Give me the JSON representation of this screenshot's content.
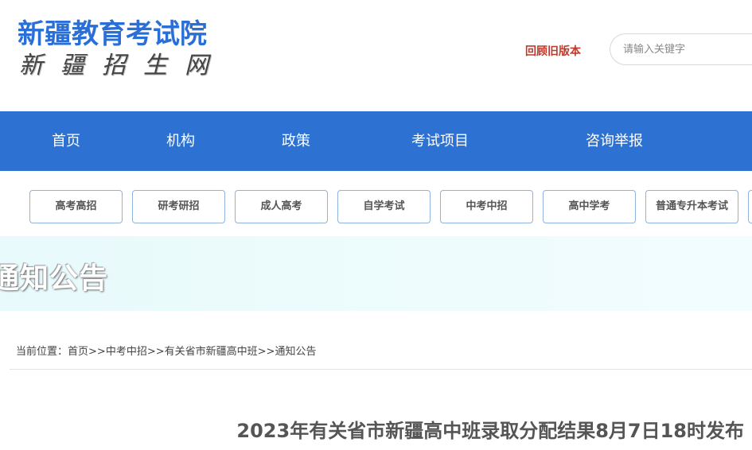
{
  "header": {
    "site_title": "新疆教育考试院",
    "site_subtitle": "新疆招生网",
    "old_version_link": "回顾旧版本",
    "search_placeholder": "请输入关键字"
  },
  "main_nav": {
    "items": [
      {
        "label": "首页"
      },
      {
        "label": "机构"
      },
      {
        "label": "政策"
      },
      {
        "label": "考试项目"
      },
      {
        "label": "咨询举报"
      }
    ]
  },
  "sub_nav": {
    "items": [
      {
        "label": "高考高招"
      },
      {
        "label": "研考研招"
      },
      {
        "label": "成人高考"
      },
      {
        "label": "自学考试"
      },
      {
        "label": "中考中招"
      },
      {
        "label": "高中学考"
      },
      {
        "label": "普通专升本考试"
      }
    ]
  },
  "banner": {
    "title": "通知公告"
  },
  "breadcrumb": {
    "prefix": "当前位置：",
    "items": [
      "首页",
      "中考中招",
      "有关省市新疆高中班",
      "通知公告"
    ],
    "separator": ">>"
  },
  "article": {
    "title": "2023年有关省市新疆高中班录取分配结果8月7日18时发布"
  },
  "colors": {
    "brand_blue": "#2d72d3",
    "title_blue": "#2a6fd6",
    "link_red": "#c0392b"
  }
}
